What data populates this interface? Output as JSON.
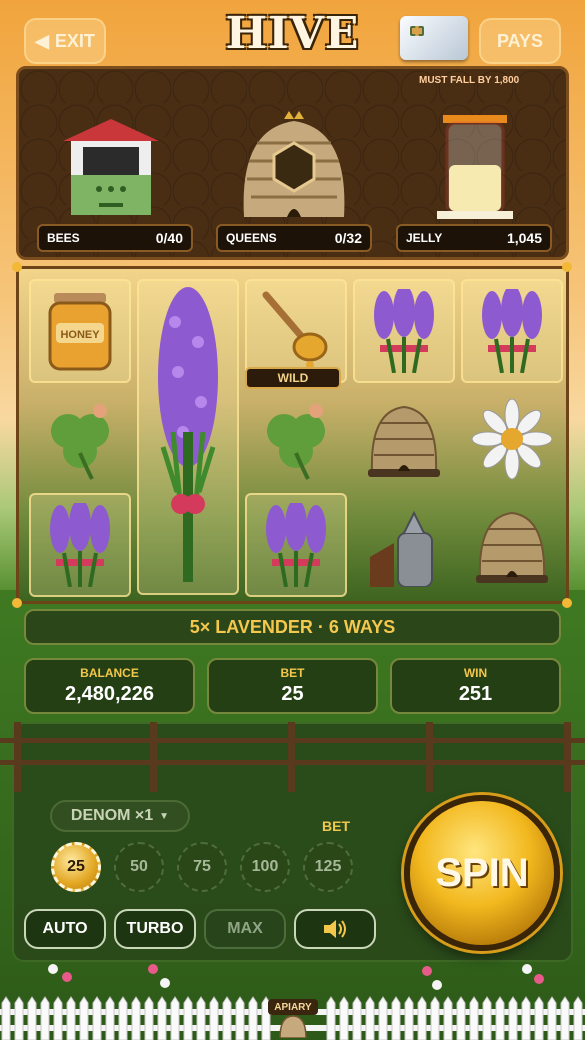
{
  "header": {
    "exit_label": "EXIT",
    "title": "HIVE",
    "pays_label": "PAYS"
  },
  "progress": {
    "note": "MUST FALL BY 1,800",
    "counters": [
      {
        "label": "BEES",
        "value": "0/40"
      },
      {
        "label": "QUEENS",
        "value": "0/32"
      },
      {
        "label": "JELLY",
        "value": "1,045"
      }
    ]
  },
  "reels": {
    "wild_label": "WILD",
    "symbols": [
      [
        "honey-jar",
        "clover",
        "lavender"
      ],
      [
        "lavender-tall",
        "lavender-tall",
        "lavender-tall"
      ],
      [
        "honey-dipper-wild",
        "clover",
        "lavender"
      ],
      [
        "lavender",
        "beehive",
        "smoker"
      ],
      [
        "lavender",
        "daisy",
        "beehive"
      ]
    ],
    "highlighted": [
      [
        0,
        0
      ],
      [
        0,
        2
      ],
      [
        1,
        0
      ],
      [
        1,
        1
      ],
      [
        1,
        2
      ],
      [
        2,
        0
      ],
      [
        2,
        2
      ],
      [
        3,
        0
      ],
      [
        4,
        0
      ]
    ]
  },
  "win_message": "5× LAVENDER · 6 WAYS",
  "stats": {
    "balance_label": "BALANCE",
    "balance_value": "2,480,226",
    "bet_label": "BET",
    "bet_value": "25",
    "win_label": "WIN",
    "win_value": "251"
  },
  "controls": {
    "denom_label": "DENOM ×1",
    "bet_label": "BET",
    "chips": [
      "25",
      "50",
      "75",
      "100",
      "125"
    ],
    "selected_chip": "25",
    "auto_label": "AUTO",
    "turbo_label": "TURBO",
    "max_label": "MAX",
    "spin_label": "SPIN"
  },
  "footer": {
    "apiary_label": "APIARY"
  },
  "colors": {
    "gold": "#f3c64c",
    "panel_green": "#253f15",
    "lavender": "#8e5ad0"
  }
}
